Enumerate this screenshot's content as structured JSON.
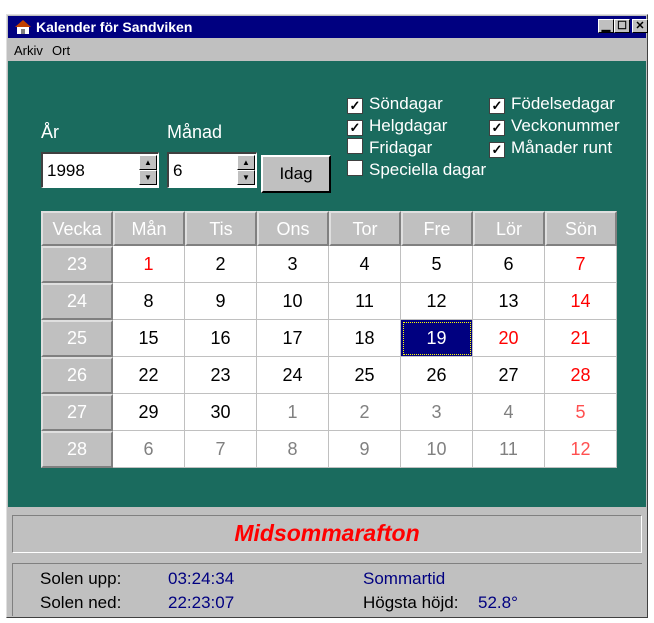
{
  "window": {
    "title": "Kalender för Sandviken",
    "controls": [
      "minimize",
      "maximize",
      "close"
    ]
  },
  "menu": {
    "arkiv": "Arkiv",
    "ort": "Ort"
  },
  "controls": {
    "year_label": "År",
    "year_value": "1998",
    "month_label": "Månad",
    "month_value": "6",
    "today_button": "Idag"
  },
  "checkboxes": [
    {
      "label": "Söndagar",
      "checked": true
    },
    {
      "label": "Helgdagar",
      "checked": true
    },
    {
      "label": "Fridagar",
      "checked": false
    },
    {
      "label": "Speciella dagar",
      "checked": false
    },
    {
      "label": "Födelsedagar",
      "checked": true
    },
    {
      "label": "Veckonummer",
      "checked": true
    },
    {
      "label": "Månader runt",
      "checked": true
    }
  ],
  "calendar": {
    "headers": [
      "Vecka",
      "Mån",
      "Tis",
      "Ons",
      "Tor",
      "Fre",
      "Lör",
      "Sön"
    ],
    "weeks": [
      "23",
      "24",
      "25",
      "26",
      "27",
      "28"
    ],
    "days": [
      [
        "1",
        "2",
        "3",
        "4",
        "5",
        "6",
        "7"
      ],
      [
        "8",
        "9",
        "10",
        "11",
        "12",
        "13",
        "14"
      ],
      [
        "15",
        "16",
        "17",
        "18",
        "19",
        "20",
        "21"
      ],
      [
        "22",
        "23",
        "24",
        "25",
        "26",
        "27",
        "28"
      ],
      [
        "29",
        "30",
        "1",
        "2",
        "3",
        "4",
        "5"
      ],
      [
        "6",
        "7",
        "8",
        "9",
        "10",
        "11",
        "12"
      ]
    ],
    "selected": "19"
  },
  "holiday_name": "Midsommarafton",
  "info": {
    "sunrise_label": "Solen upp:",
    "sunrise_value": "03:24:34",
    "sunset_label": "Solen ned:",
    "sunset_value": "22:23:07",
    "time_mode": "Sommartid",
    "max_height_label": "Högsta höjd:",
    "max_height_value": "52.8°"
  },
  "colors": {
    "panel": "#1a6b5e",
    "holiday_text": "#ff0000",
    "selected_bg": "#000080"
  }
}
